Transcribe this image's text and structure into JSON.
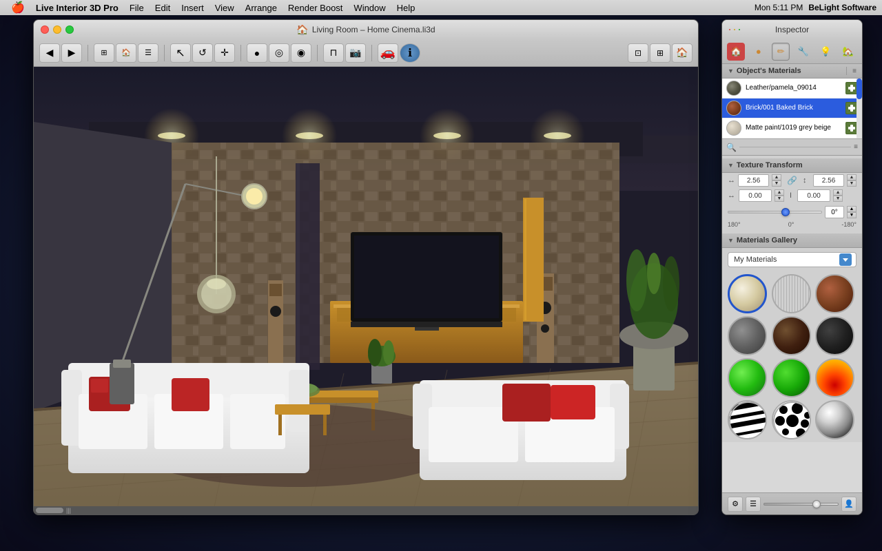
{
  "menubar": {
    "apple": "🍎",
    "items": [
      {
        "label": "Live Interior 3D Pro"
      },
      {
        "label": "File"
      },
      {
        "label": "Edit"
      },
      {
        "label": "Insert"
      },
      {
        "label": "View"
      },
      {
        "label": "Arrange"
      },
      {
        "label": "Render Boost"
      },
      {
        "label": "Window"
      },
      {
        "label": "Help"
      }
    ],
    "right": {
      "time": "Mon 5:11 PM",
      "brand": "BeLight Software"
    }
  },
  "window": {
    "title": "Living Room – Home Cinema.li3d",
    "title_icon": "🏠"
  },
  "inspector": {
    "title": "Inspector",
    "tabs": [
      {
        "icon": "🏠",
        "label": "home"
      },
      {
        "icon": "⚙️",
        "label": "settings"
      },
      {
        "icon": "✏️",
        "label": "edit"
      },
      {
        "icon": "🔧",
        "label": "materials"
      },
      {
        "icon": "💡",
        "label": "light"
      },
      {
        "icon": "🏡",
        "label": "scene"
      }
    ],
    "objects_materials": {
      "header": "Object's Materials",
      "materials": [
        {
          "name": "Leather/pamela_09014",
          "selected": false,
          "type": "leather"
        },
        {
          "name": "Brick/001 Baked Brick",
          "selected": true,
          "type": "brick"
        },
        {
          "name": "Matte paint/1019 grey beige",
          "selected": false,
          "type": "matte"
        }
      ]
    },
    "texture_transform": {
      "header": "Texture Transform",
      "scale_x": "2.56",
      "scale_y": "2.56",
      "offset_x": "0.00",
      "offset_y": "0.00",
      "angle": "0°",
      "angle_min": "180°",
      "angle_mid": "0°",
      "angle_max": "-180°"
    },
    "materials_gallery": {
      "header": "Materials Gallery",
      "dropdown_label": "My Materials",
      "items": [
        {
          "type": "cream",
          "selected": true
        },
        {
          "type": "wood1",
          "selected": false
        },
        {
          "type": "brick",
          "selected": false
        },
        {
          "type": "concrete",
          "selected": false
        },
        {
          "type": "darkwood",
          "selected": false
        },
        {
          "type": "verydark",
          "selected": false
        },
        {
          "type": "green1",
          "selected": false
        },
        {
          "type": "green2",
          "selected": false
        },
        {
          "type": "fire",
          "selected": false
        },
        {
          "type": "zebra",
          "selected": false
        },
        {
          "type": "spots",
          "selected": false
        },
        {
          "type": "chrome",
          "selected": false
        }
      ]
    },
    "bottom": {
      "add_icon": "⚙",
      "list_icon": "☰",
      "person_icon": "👤"
    }
  }
}
